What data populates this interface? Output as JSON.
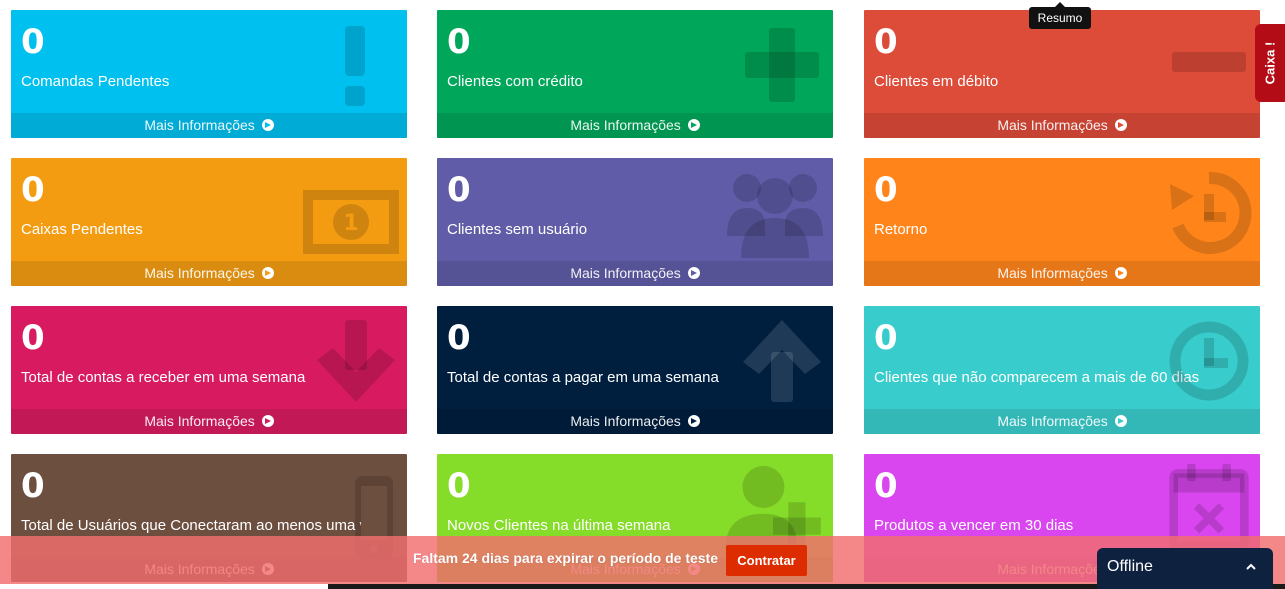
{
  "more_info": "Mais Informações",
  "cards": [
    {
      "value": "0",
      "label": "Comandas Pendentes",
      "icon": "exclamation-icon"
    },
    {
      "value": "0",
      "label": "Clientes com crédito",
      "icon": "plus-icon"
    },
    {
      "value": "0",
      "label": "Clientes em débito",
      "icon": "minus-icon"
    },
    {
      "value": "0",
      "label": "Caixas Pendentes",
      "icon": "money-bill-icon"
    },
    {
      "value": "0",
      "label": "Clientes sem usuário",
      "icon": "users-icon"
    },
    {
      "value": "0",
      "label": "Retorno",
      "icon": "history-icon"
    },
    {
      "value": "0",
      "label": "Total de contas a receber em uma semana",
      "icon": "arrow-down-icon"
    },
    {
      "value": "0",
      "label": "Total de contas a pagar em uma semana",
      "icon": "arrow-up-icon"
    },
    {
      "value": "0",
      "label": "Clientes que não comparecem a mais de 60 dias",
      "icon": "clock-icon"
    },
    {
      "value": "0",
      "label": "Total de Usuários que Conectaram ao menos uma vez",
      "icon": "mobile-icon"
    },
    {
      "value": "0",
      "label": "Novos Clientes na última semana",
      "icon": "user-plus-icon"
    },
    {
      "value": "0",
      "label": "Produtos a vencer em 30 dias",
      "icon": "calendar-times-icon"
    }
  ],
  "colors": {
    "aqua": "#00c0ef",
    "green": "#00a65a",
    "red": "#dd4b39",
    "yellow": "#f39c12",
    "purple": "#605ca8",
    "orange": "#ff851b",
    "maroon": "#d81b60",
    "navy": "#001f3f",
    "teal": "#39cccc",
    "brown": "#6d4f40",
    "lime": "#86dd29",
    "fuchsia": "#d946ef"
  },
  "tooltip": "Resumo",
  "caixa_tab": "Caixa",
  "trial": {
    "text": "Faltam 24 dias para expirar o período de teste",
    "button": "Contratar"
  },
  "chat": {
    "status": "Offline"
  }
}
